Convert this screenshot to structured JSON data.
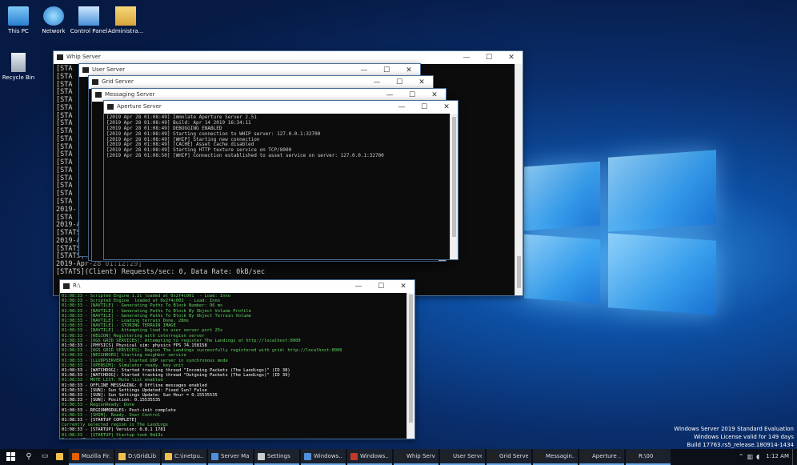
{
  "desktop": {
    "icons": [
      {
        "label": "This PC"
      },
      {
        "label": "Network"
      },
      {
        "label": "Control Panel"
      },
      {
        "label": "Administra..."
      },
      {
        "label": "Recycle Bin"
      }
    ]
  },
  "windows": {
    "whip": {
      "title": "Whip Server",
      "lines": [
        "[STA",
        "[STA",
        "[STA",
        "[STA",
        "[STA",
        "[STA",
        "[STA",
        "[STA",
        "[STA",
        "[STA",
        "[STA",
        "[STA",
        "[STA",
        "[STA",
        "[STA",
        "[STA",
        "[STA",
        "[STA",
        "2019-",
        "[STA",
        "2019-Apr-2",
        "[STATS](Me",
        "2019-Apr-28",
        "[STATS](Clien",
        "[STATS](Mesh) Requests: 0(0/sec), Positive Req: 0, Data Rate: 0kB/sec",
        "2019-Apr-28 01:12:29]",
        "[STATS](Client) Requests/sec: 0, Data Rate: 0kB/sec"
      ]
    },
    "user": {
      "title": "User Server"
    },
    "grid": {
      "title": "Grid Server"
    },
    "messaging": {
      "title": "Messaging Server"
    },
    "aperture": {
      "title": "Aperture Server",
      "lines": [
        "[2019 Apr 28 01:08:49] Immolate Aperture Server 2.51",
        "[2019 Apr 28 01:08:49] Build: Apr 14 2019 16:34:11",
        "[2019 Apr 28 01:08:49] DEBUGGING ENABLED",
        "[2019 Apr 28 01:08:49] Starting connection to WHIP server: 127.0.0.1:32700",
        "[2019 Apr 28 01:08:49] [WHIP] Starting new connection",
        "[2019 Apr 28 01:08:49] [CACHE] Asset cache disabled",
        "[2019 Apr 28 01:08:49] Starting HTTP texture service on TCP/8000",
        "[2019 Apr 28 01:08:50] [WHIP] Connection established to asset service on server: 127.0.0.1:32700"
      ]
    },
    "r64": {
      "title": "R:\\",
      "lines": [
        {
          "t": "01:08:33 - Scripted Engine 1.2c loaded at 0x2f4c001  - Load: Inno",
          "c": "#5fd35f"
        },
        {
          "t": "01:08:33 - Scripted Engine  loaded at 0x2f4c003  - Load: Inno",
          "c": "#5fd35f"
        },
        {
          "t": "01:08:33 - [NAVTILE] - Generating Paths To Block Number: 96 ms",
          "c": "#5fd35f"
        },
        {
          "t": "01:08:33 - [NAVTILE] - Generating Paths To Block By Object Volume Profile",
          "c": "#5fd35f"
        },
        {
          "t": "01:08:33 - [NAVTILE] - Generating Paths To Block By Object Terrain Volume",
          "c": "#5fd35f"
        },
        {
          "t": "01:08:33 - [NAVTILE] - Loading terrain Done. 28ms",
          "c": "#5fd35f"
        },
        {
          "t": "01:08:33 - [NAVTILE] - STORING TERRAIN IMAGE",
          "c": "#5fd35f"
        },
        {
          "t": "01:08:33 - [NAVTILE] - Attempting load to user server port 25s",
          "c": "#5fd35f"
        },
        {
          "t": "01:08:33 - [REGION] Registering with interregion server",
          "c": "#5fd35f"
        },
        {
          "t": "01:08:33 - [OGS GRID SERVICES]: Attempting to register The Landings at http://localhost:8000",
          "c": "#5fd35f"
        },
        {
          "t": "01:08:33 - [PHYSICS] Physical sim: physics FPS 74.158158",
          "c": "#ffffff"
        },
        {
          "t": "01:08:33 - [OGS GRID SERVICES]: Region The Landings successfully registered with grid: http://localhost:8006",
          "c": "#5fd35f"
        },
        {
          "t": "01:08:33 - [NEIGHBORS] Starting neighbor service",
          "c": "#5fd35f"
        },
        {
          "t": "01:08:33 - [LLUDPSERVER]: Started UDP server in synchronous mode",
          "c": "#5fd35f"
        },
        {
          "t": "01:08:33 - [OPENSIM]: Simulator ready. key unit",
          "c": "#5fd35f"
        },
        {
          "t": "01:08:33 - [WATCHDOG]: Started tracking thread \"Incoming Packets (The Landings)\" (ID 38)",
          "c": "#ffffff"
        },
        {
          "t": "01:08:33 - [WATCHDOG]: Started tracking thread \"Outgoing Packets (The Landings)\" (ID 39)",
          "c": "#ffffff"
        },
        {
          "t": "01:08:33 - MUTE LIST: Mute list enabled",
          "c": "#5fd35f"
        },
        {
          "t": "01:08:33 - OFFLINE MESSAGING: 0 Offline messages enabled",
          "c": "#ffffff"
        },
        {
          "t": "01:08:33 - [SUN]: Sun Settings Updated: Fixed Sun? False",
          "c": "#ffffff"
        },
        {
          "t": "01:08:33 - [SUN]: Sun Settings Update: Sun Hour = 0.15535535",
          "c": "#ffffff"
        },
        {
          "t": "01:08:33 - [SUN]: Position: 0.15535535",
          "c": "#ffffff"
        },
        {
          "t": "01:08:33 - RegionReady: Done",
          "c": "#5fd35f"
        },
        {
          "t": "01:08:33 - REGIONMODULES: Post-init complete",
          "c": "#ffffff"
        },
        {
          "t": "01:08:33 - [SHIM]: Ready. User Control",
          "c": "#5fd35f"
        },
        {
          "t": "01:08:33 - [STARTUP COMPLETE]",
          "c": "#ffffff"
        },
        {
          "t": "Currently selected region is The Landings",
          "c": "#5fd35f"
        },
        {
          "t": "01:08:33 - [STARTUP] Version: 0.8.1 1781",
          "c": "#ffffff"
        },
        {
          "t": "01:08:33 - [STARTUP] Startup took 0m13s",
          "c": "#5fd35f"
        },
        {
          "t": "Region (The Landings) #",
          "c": "#5fd35f"
        }
      ]
    }
  },
  "taskbar": {
    "items": [
      {
        "label": "Mozilla Fir...",
        "color": "#e66000"
      },
      {
        "label": "D:\\GridLib...",
        "color": "#f0c050"
      },
      {
        "label": "C:\\inetpu...",
        "color": "#f0c050"
      },
      {
        "label": "Server Ma...",
        "color": "#4f8fd8"
      },
      {
        "label": "Settings",
        "color": "#cccccc"
      },
      {
        "label": "Windows...",
        "color": "#4f8fd8"
      },
      {
        "label": "Windows...",
        "color": "#c0392b"
      },
      {
        "label": "Whip Serv...",
        "color": "#222222"
      },
      {
        "label": "User Server",
        "color": "#222222"
      },
      {
        "label": "Grid Server",
        "color": "#222222"
      },
      {
        "label": "Messagin...",
        "color": "#222222"
      },
      {
        "label": "Aperture ...",
        "color": "#222222"
      },
      {
        "label": "R:\\00",
        "color": "#222222"
      }
    ],
    "clock": "1:12 AM"
  },
  "watermark": {
    "line1": "Windows Server 2019 Standard Evaluation",
    "line2": "Windows License valid for 149 days",
    "line3": "Build 17763.rs5_release.180914-1434"
  }
}
